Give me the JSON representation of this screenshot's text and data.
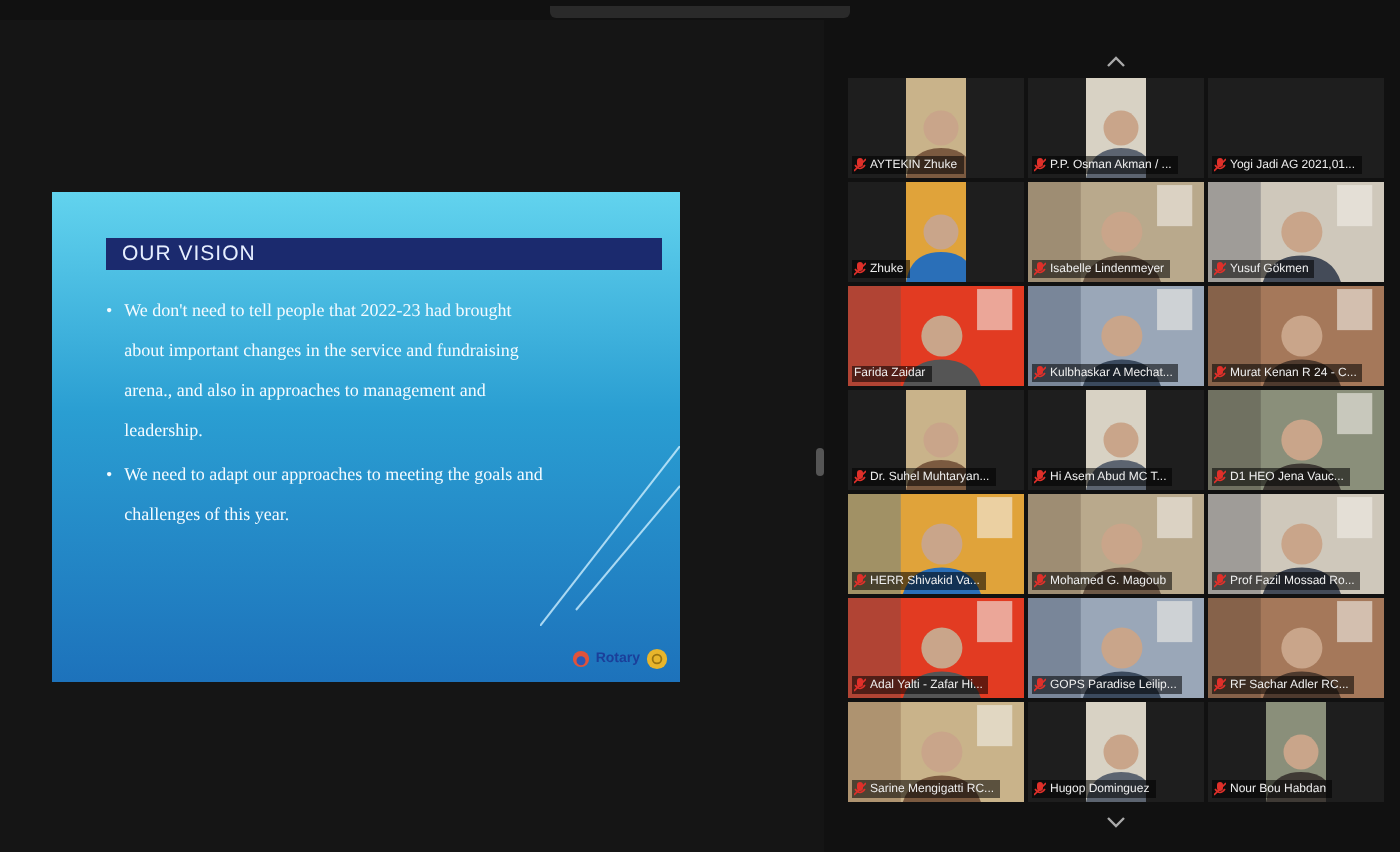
{
  "slide": {
    "title": "OUR VISION",
    "bullet_marker": "•",
    "bullets": [
      "We don't need to tell people that 2022-23 had brought about important changes in the service and fundraising arena., and also in approaches to management and leadership.",
      "We need to adapt our approaches to meeting the goals and challenges of this year."
    ],
    "logo_text": "Rotary"
  },
  "gallery": {
    "participants": [
      {
        "name": "AYTEKIN Zhuke",
        "muted": true,
        "kind": "portrait"
      },
      {
        "name": "P.P. Osman Akman / ...",
        "muted": true,
        "kind": "portrait"
      },
      {
        "name": "Yogi Jadi AG 2021,01...",
        "muted": true,
        "kind": "none"
      },
      {
        "name": "Zhuke",
        "muted": true,
        "kind": "portrait"
      },
      {
        "name": "Isabelle Lindenmeyer",
        "muted": true,
        "kind": "picture"
      },
      {
        "name": "Yusuf Gökmen",
        "muted": true,
        "kind": "picture"
      },
      {
        "name": "Farida Zaidar",
        "muted": false,
        "kind": "picture"
      },
      {
        "name": "Kulbhaskar A Mechat...",
        "muted": true,
        "kind": "picture"
      },
      {
        "name": "Murat Kenan R 24 - C...",
        "muted": true,
        "kind": "picture"
      },
      {
        "name": "Dr. Suhel Muhtaryan...",
        "muted": true,
        "kind": "portrait"
      },
      {
        "name": "Hi Asem Abud MC T...",
        "muted": true,
        "kind": "portrait"
      },
      {
        "name": "D1 HEO Jena Vauc...",
        "muted": true,
        "kind": "picture"
      },
      {
        "name": "HERR Shivakid Va...",
        "muted": true,
        "kind": "picture"
      },
      {
        "name": "Mohamed G. Magoub",
        "muted": true,
        "kind": "picture"
      },
      {
        "name": "Prof Fazil Mossad Ro...",
        "muted": true,
        "kind": "picture"
      },
      {
        "name": "Adal Yalti - Zafar Hi...",
        "muted": true,
        "kind": "picture"
      },
      {
        "name": "GOPS Paradise Leilip...",
        "muted": true,
        "kind": "picture"
      },
      {
        "name": "RF Sachar Adler RC...",
        "muted": true,
        "kind": "picture"
      },
      {
        "name": "Sarine Mengigatti RC...",
        "muted": true,
        "kind": "picture"
      },
      {
        "name": "Hugop Dominguez",
        "muted": true,
        "kind": "portrait"
      },
      {
        "name": "Nour Bou Habdan",
        "muted": true,
        "kind": "portrait"
      }
    ]
  }
}
